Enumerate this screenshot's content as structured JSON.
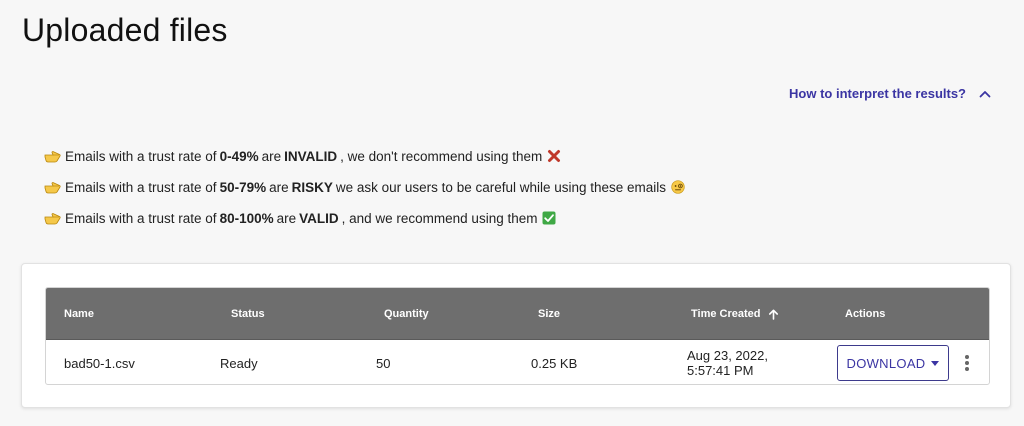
{
  "page": {
    "title": "Uploaded files"
  },
  "interpret": {
    "label": "How to interpret the results?"
  },
  "rules": [
    {
      "prefix": "Emails with a trust rate of",
      "range": "0-49%",
      "mid": "are",
      "verdict": "INVALID",
      "suffix": ", we don't recommend using them",
      "icon": "cross-mark-icon"
    },
    {
      "prefix": "Emails with a trust rate of",
      "range": "50-79%",
      "mid": "are",
      "verdict": "RISKY",
      "suffix": "we ask our users to be careful while using these emails",
      "icon": "monocle-face-icon"
    },
    {
      "prefix": "Emails with a trust rate of",
      "range": "80-100%",
      "mid": "are",
      "verdict": "VALID",
      "suffix": ", and we recommend using them",
      "icon": "check-mark-icon"
    }
  ],
  "table": {
    "columns": [
      "Name",
      "Status",
      "Quantity",
      "Size",
      "Time Created",
      "Actions"
    ],
    "rows": [
      {
        "name": "bad50-1.csv",
        "status": "Ready",
        "quantity": "50",
        "size": "0.25 KB",
        "time_created": "Aug 23, 2022, 5:57:41 PM"
      }
    ],
    "download_label": "DOWNLOAD"
  },
  "colors": {
    "accent": "#3b35a3",
    "header_bg": "#6e6e6e",
    "page_bg": "#f7f7f7"
  }
}
